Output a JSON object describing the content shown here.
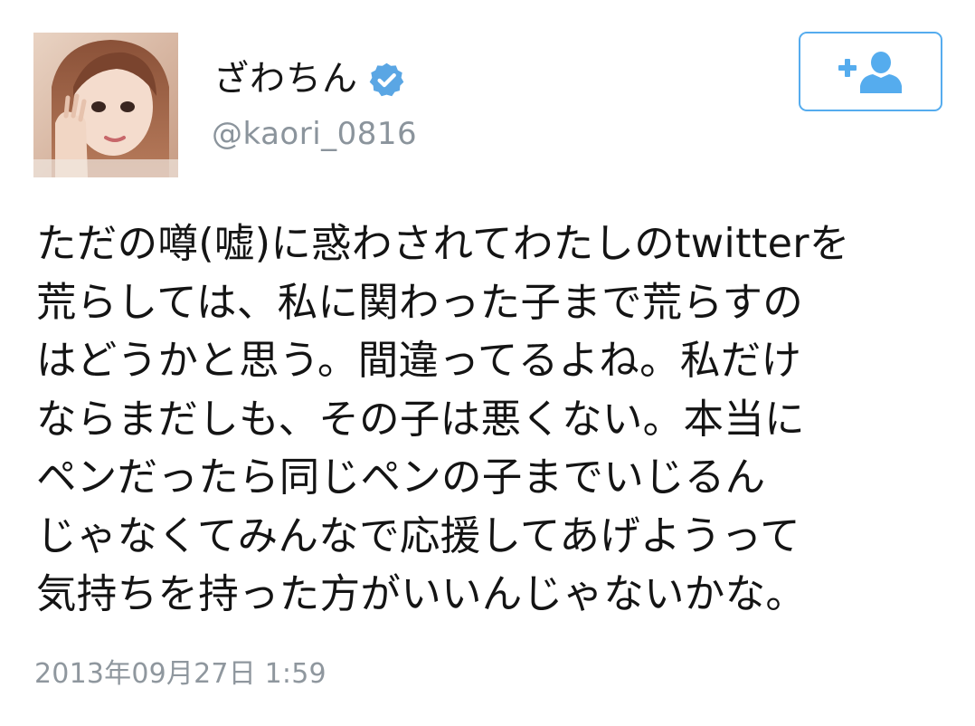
{
  "user": {
    "display_name": "ざわちん",
    "handle": "@kaori_0816",
    "verified": true,
    "avatar_icon": "profile-photo"
  },
  "follow_button": {
    "icon": "add-user-icon",
    "color": "#55acee"
  },
  "tweet": {
    "lines": [
      "ただの噂(嘘)に惑わされてわたしのtwitterを",
      "荒らしては、私に関わった子まで荒らすの",
      "はどうかと思う。間違ってるよね。私だけ",
      "ならまだしも、その子は悪くない。本当に",
      "ペンだったら同じペンの子までいじるん",
      "じゃなくてみんなで応援してあげようって",
      "気持ちを持った方がいいんじゃないかな。"
    ],
    "timestamp": "2013年09月27日 1:59"
  },
  "colors": {
    "accent": "#55acee",
    "verified_badge": "#5aa6e4",
    "secondary_text": "#8b949c"
  }
}
